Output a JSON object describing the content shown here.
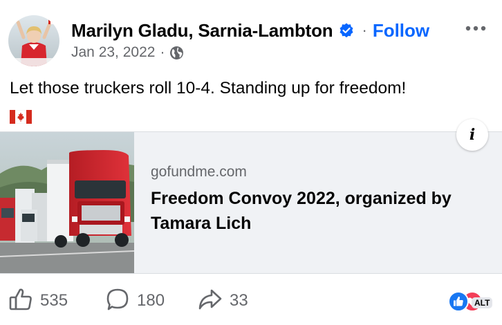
{
  "post": {
    "author": "Marilyn Gladu, Sarnia-Lambton",
    "verified_icon": "verified-badge-icon",
    "separator": "·",
    "follow_label": "Follow",
    "more_icon": "more-options-icon",
    "date": "Jan 23, 2022",
    "audience_icon": "globe-icon",
    "text": "Let those truckers roll 10-4. Standing up for freedom!",
    "emoji": "canada-flag-icon"
  },
  "link_preview": {
    "domain": "gofundme.com",
    "title": "Freedom Convoy 2022, organized by Tamara Lich",
    "info_label": "i",
    "thumbnail": "red-semi-trucks-convoy-image"
  },
  "actions": {
    "like_count": "535",
    "comment_count": "180",
    "share_count": "33"
  },
  "reactions": {
    "alt_label": "ALT"
  },
  "colors": {
    "accent": "#0866ff",
    "text": "#050505",
    "secondary_text": "#65676b",
    "card_background": "#f0f2f5"
  }
}
